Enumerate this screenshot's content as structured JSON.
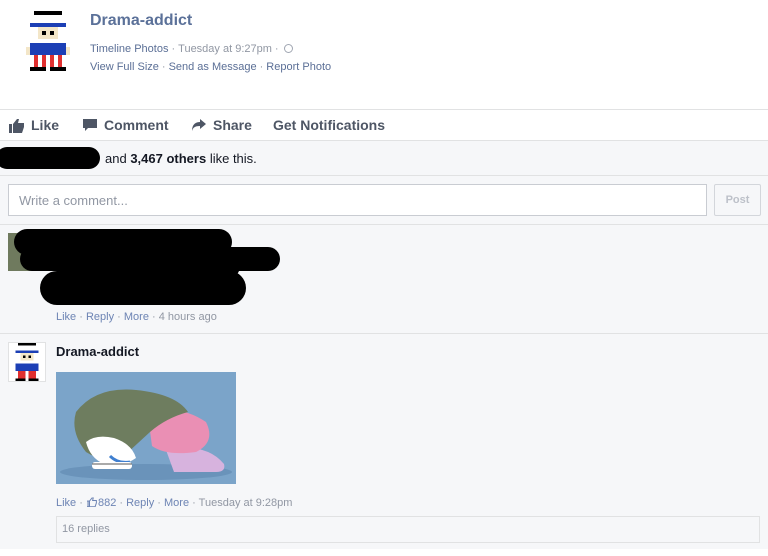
{
  "header": {
    "page_name": "Drama-addict",
    "album": "Timeline Photos",
    "timestamp": "Tuesday at 9:27pm",
    "audience_icon": "globe-icon",
    "links": {
      "view_full_size": "View Full Size",
      "send_as_message": "Send as Message",
      "report_photo": "Report Photo"
    }
  },
  "actions": {
    "like": "Like",
    "comment": "Comment",
    "share": "Share",
    "notifications": "Get Notifications"
  },
  "likes": {
    "and": "and",
    "count": "3,467 others",
    "suffix": "like this."
  },
  "comment_input": {
    "placeholder": "Write a comment...",
    "post_label": "Post"
  },
  "comments": [
    {
      "author": "",
      "meta": {
        "like": "Like",
        "reply": "Reply",
        "more": "More",
        "time": "4 hours ago"
      }
    },
    {
      "author": "Drama-addict",
      "meta": {
        "like": "Like",
        "like_count": "882",
        "reply": "Reply",
        "more": "More",
        "time": "Tuesday at 9:28pm"
      },
      "replies": "16 replies"
    }
  ],
  "colors": {
    "link": "#5b6f96",
    "muted": "#9197a3",
    "panel": "#f6f7f9",
    "border": "#e1e2e3"
  }
}
